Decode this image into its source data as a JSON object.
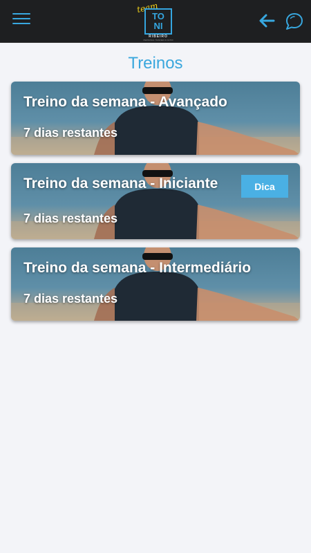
{
  "header": {
    "logo_script": "team",
    "logo_line1": "TO",
    "logo_line2": "NI",
    "logo_line3": "RIBEIRO",
    "logo_tagline": "PERSONAL TRAINER & NUTRI",
    "menu_icon": "hamburger-menu-icon",
    "back_icon": "arrow-left-icon",
    "chat_icon": "chat-bubble-icon",
    "accent_color": "#3aa7dd"
  },
  "page": {
    "title": "Treinos"
  },
  "workouts": [
    {
      "title": "Treino da semana - Avançado",
      "remaining": "7 dias restantes",
      "has_tip": false
    },
    {
      "title": "Treino da semana - Iniciante",
      "remaining": "7 dias restantes",
      "has_tip": true,
      "tip_label": "Dica"
    },
    {
      "title": "Treino da semana - Intermediário",
      "remaining": "7 dias restantes",
      "has_tip": false
    }
  ]
}
